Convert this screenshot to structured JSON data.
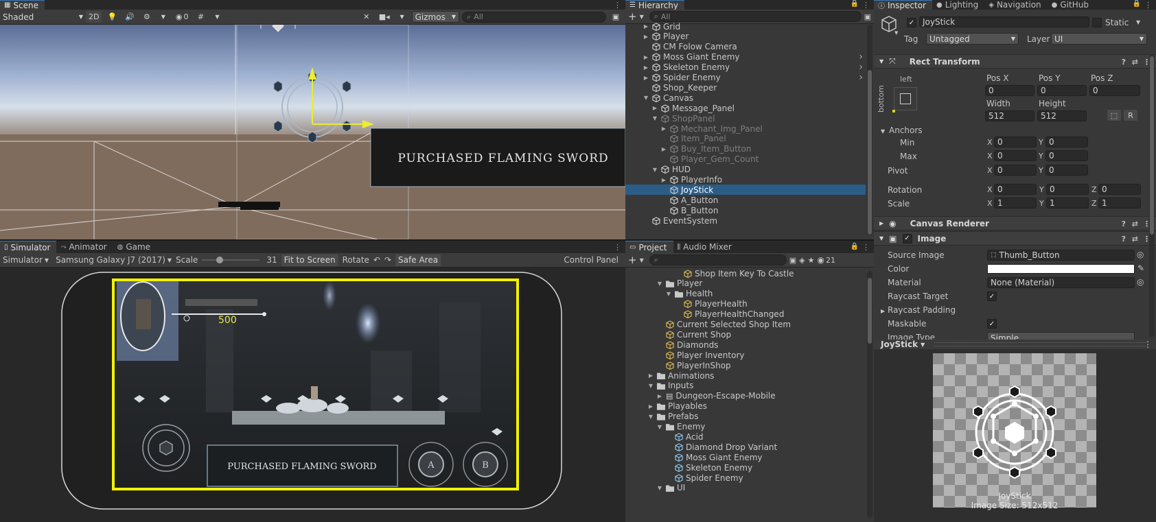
{
  "scene": {
    "tabs": [
      "Scene"
    ],
    "shading": "Shaded",
    "mode_2d": "2D",
    "hidden_count": "0",
    "gizmos": "Gizmos",
    "search_placeholder": "All",
    "banner_text": "PURCHASED FLAMING SWORD"
  },
  "hierarchy": {
    "tab": "Hierarchy",
    "search_placeholder": "All",
    "items": [
      {
        "label": "Grid",
        "depth": 1,
        "expander": "collapsed",
        "dim": false,
        "selected": false,
        "more": false
      },
      {
        "label": "Player",
        "depth": 1,
        "expander": "collapsed",
        "dim": false,
        "selected": false,
        "more": false
      },
      {
        "label": "CM Folow Camera",
        "depth": 1,
        "expander": "none",
        "dim": false,
        "selected": false,
        "more": false
      },
      {
        "label": "Moss Giant Enemy",
        "depth": 1,
        "expander": "collapsed",
        "dim": false,
        "selected": false,
        "more": true
      },
      {
        "label": "Skeleton Enemy",
        "depth": 1,
        "expander": "collapsed",
        "dim": false,
        "selected": false,
        "more": true
      },
      {
        "label": "Spider Enemy",
        "depth": 1,
        "expander": "collapsed",
        "dim": false,
        "selected": false,
        "more": true
      },
      {
        "label": "Shop_Keeper",
        "depth": 1,
        "expander": "none",
        "dim": false,
        "selected": false,
        "more": false
      },
      {
        "label": "Canvas",
        "depth": 1,
        "expander": "expanded",
        "dim": false,
        "selected": false,
        "more": false
      },
      {
        "label": "Message_Panel",
        "depth": 2,
        "expander": "collapsed",
        "dim": false,
        "selected": false,
        "more": false
      },
      {
        "label": "ShopPanel",
        "depth": 2,
        "expander": "expanded",
        "dim": true,
        "selected": false,
        "more": false
      },
      {
        "label": "Mechant_Img_Panel",
        "depth": 3,
        "expander": "collapsed",
        "dim": true,
        "selected": false,
        "more": false
      },
      {
        "label": "Item_Panel",
        "depth": 3,
        "expander": "none",
        "dim": true,
        "selected": false,
        "more": false
      },
      {
        "label": "Buy_Item_Button",
        "depth": 3,
        "expander": "collapsed",
        "dim": true,
        "selected": false,
        "more": false
      },
      {
        "label": "Player_Gem_Count",
        "depth": 3,
        "expander": "none",
        "dim": true,
        "selected": false,
        "more": false
      },
      {
        "label": "HUD",
        "depth": 2,
        "expander": "expanded",
        "dim": false,
        "selected": false,
        "more": false
      },
      {
        "label": "PlayerInfo",
        "depth": 3,
        "expander": "collapsed",
        "dim": false,
        "selected": false,
        "more": false
      },
      {
        "label": "JoyStick",
        "depth": 3,
        "expander": "none",
        "dim": false,
        "selected": true,
        "more": false
      },
      {
        "label": "A_Button",
        "depth": 3,
        "expander": "none",
        "dim": false,
        "selected": false,
        "more": false
      },
      {
        "label": "B_Button",
        "depth": 3,
        "expander": "none",
        "dim": false,
        "selected": false,
        "more": false
      },
      {
        "label": "EventSystem",
        "depth": 1,
        "expander": "none",
        "dim": false,
        "selected": false,
        "more": false
      }
    ]
  },
  "inspector": {
    "tabs": [
      "Inspector",
      "Lighting",
      "Navigation",
      "GitHub"
    ],
    "object_name": "JoyStick",
    "static_label": "Static",
    "tag_label": "Tag",
    "tag_value": "Untagged",
    "layer_label": "Layer",
    "layer_value": "UI",
    "rect_title": "Rect Transform",
    "anchor_h": "left",
    "anchor_v": "bottom",
    "pos_x_label": "Pos X",
    "pos_x": "0",
    "pos_y_label": "Pos Y",
    "pos_y": "0",
    "pos_z_label": "Pos Z",
    "pos_z": "0",
    "width_label": "Width",
    "width": "512",
    "height_label": "Height",
    "height": "512",
    "anchors_label": "Anchors",
    "min_label": "Min",
    "min_x": "0",
    "min_y": "0",
    "max_label": "Max",
    "max_x": "0",
    "max_y": "0",
    "pivot_label": "Pivot",
    "pivot_x": "0",
    "pivot_y": "0",
    "rotation_label": "Rotation",
    "rot_x": "0",
    "rot_y": "0",
    "rot_z": "0",
    "scale_label": "Scale",
    "scale_x": "1",
    "scale_y": "1",
    "scale_z": "1",
    "x_label": "X",
    "y_label": "Y",
    "z_label": "Z",
    "canvas_renderer": "Canvas Renderer",
    "image_title": "Image",
    "source_image_label": "Source Image",
    "source_image": "Thumb_Button",
    "color_label": "Color",
    "material_label": "Material",
    "material": "None (Material)",
    "raycast_target_label": "Raycast Target",
    "raycast_padding_label": "Raycast Padding",
    "maskable_label": "Maskable",
    "image_type_label": "Image Type",
    "image_type": "Simple"
  },
  "preview": {
    "title": "JoyStick",
    "caption_name": "JoyStick",
    "caption_size": "Image Size: 512x512"
  },
  "simulator": {
    "tabs": [
      "Simulator",
      "Animator",
      "Game"
    ],
    "mode": "Simulator",
    "device": "Samsung Galaxy J7 (2017)",
    "scale_label": "Scale",
    "scale_value": "31",
    "scale_fraction": 0.31,
    "fit_label": "Fit to Screen",
    "rotate_label": "Rotate",
    "safe_area_label": "Safe Area",
    "control_panel_label": "Control Panel",
    "hud_value": "500",
    "banner_text": "PURCHASED FLAMING SWORD",
    "a_label": "A",
    "b_label": "B"
  },
  "project": {
    "tabs": [
      "Project",
      "Audio Mixer"
    ],
    "hidden_count": "21",
    "items": [
      {
        "label": "Shop Item Key To Castle",
        "depth": 3,
        "kind": "asset",
        "expander": "none"
      },
      {
        "label": "Player",
        "depth": 1,
        "kind": "folder",
        "expander": "expanded"
      },
      {
        "label": "Health",
        "depth": 2,
        "kind": "folder",
        "expander": "expanded"
      },
      {
        "label": "PlayerHealth",
        "depth": 3,
        "kind": "asset",
        "expander": "none"
      },
      {
        "label": "PlayerHealthChanged",
        "depth": 3,
        "kind": "asset",
        "expander": "none"
      },
      {
        "label": "Current Selected Shop Item",
        "depth": 1,
        "kind": "asset",
        "expander": "none"
      },
      {
        "label": "Current Shop",
        "depth": 1,
        "kind": "asset",
        "expander": "none"
      },
      {
        "label": "Diamonds",
        "depth": 1,
        "kind": "asset",
        "expander": "none"
      },
      {
        "label": "Player Inventory",
        "depth": 1,
        "kind": "asset",
        "expander": "none"
      },
      {
        "label": "PlayerInShop",
        "depth": 1,
        "kind": "asset",
        "expander": "none"
      },
      {
        "label": "Animations",
        "depth": 0,
        "kind": "folder",
        "expander": "collapsed"
      },
      {
        "label": "Inputs",
        "depth": 0,
        "kind": "folder",
        "expander": "expanded"
      },
      {
        "label": "Dungeon-Escape-Mobile",
        "depth": 1,
        "kind": "input",
        "expander": "collapsed"
      },
      {
        "label": "Playables",
        "depth": 0,
        "kind": "folder",
        "expander": "collapsed"
      },
      {
        "label": "Prefabs",
        "depth": 0,
        "kind": "folder",
        "expander": "expanded"
      },
      {
        "label": "Enemy",
        "depth": 1,
        "kind": "folder",
        "expander": "expanded"
      },
      {
        "label": "Acid",
        "depth": 2,
        "kind": "prefab",
        "expander": "none"
      },
      {
        "label": "Diamond Drop Variant",
        "depth": 2,
        "kind": "prefab",
        "expander": "none"
      },
      {
        "label": "Moss Giant Enemy",
        "depth": 2,
        "kind": "prefab",
        "expander": "none"
      },
      {
        "label": "Skeleton Enemy",
        "depth": 2,
        "kind": "prefab",
        "expander": "none"
      },
      {
        "label": "Spider Enemy",
        "depth": 2,
        "kind": "prefab",
        "expander": "none"
      },
      {
        "label": "UI",
        "depth": 1,
        "kind": "folder",
        "expander": "expanded"
      }
    ]
  },
  "colors": {
    "selection": "#2c5d87",
    "accent_tab": "#3a79bb",
    "safe_area_yellow": "#f2f200",
    "scene_gizmo_yellow": "#ecec33"
  }
}
